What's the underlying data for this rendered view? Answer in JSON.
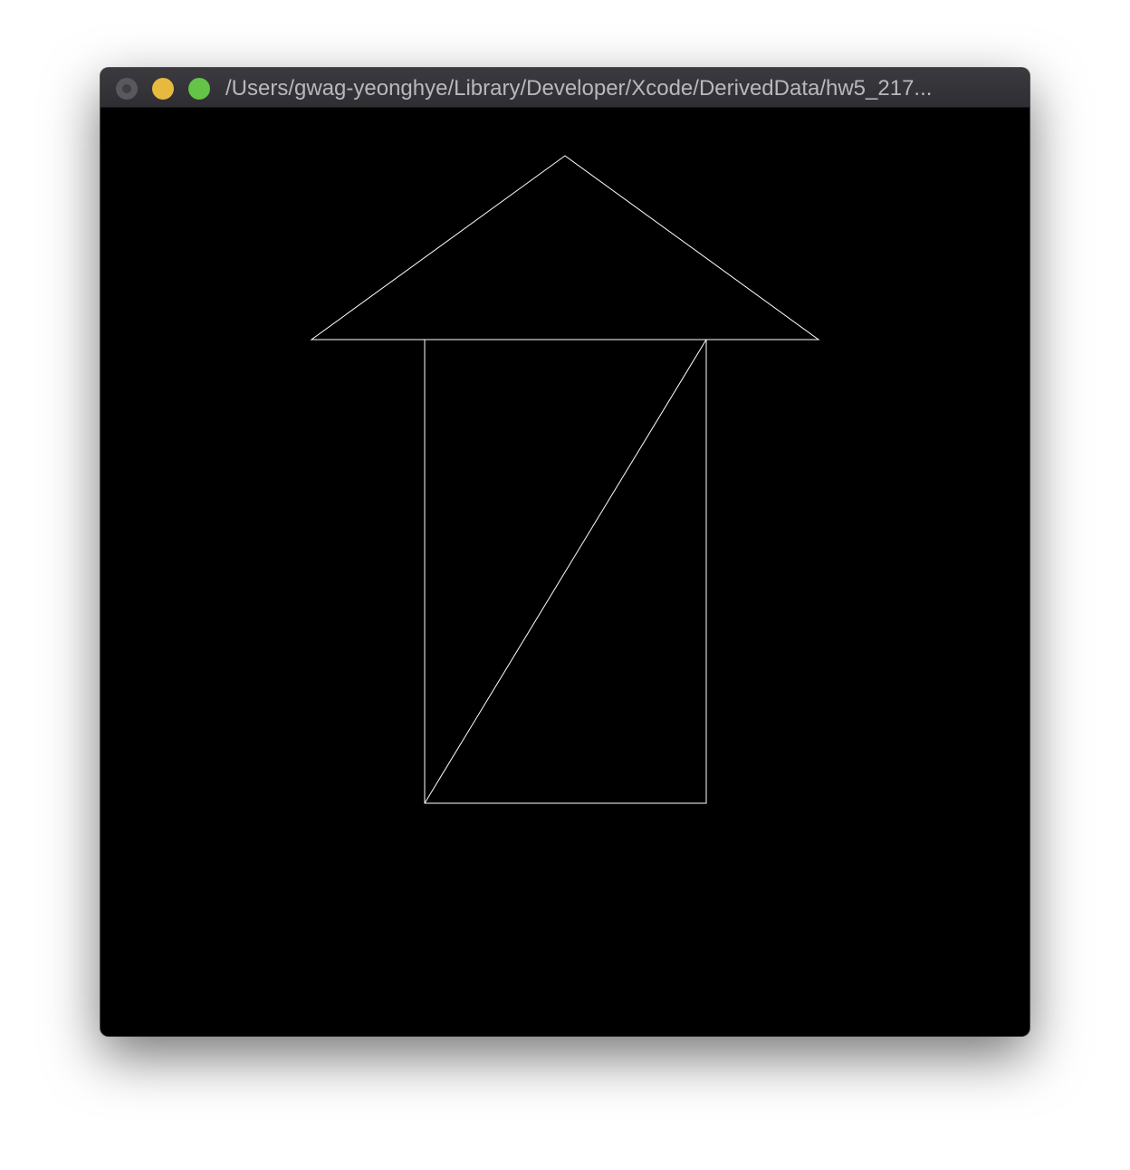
{
  "window": {
    "title": "/Users/gwag-yeonghye/Library/Developer/Xcode/DerivedData/hw5_217...",
    "controls": {
      "close_icon": "close-icon",
      "minimize_icon": "minimize-icon",
      "maximize_icon": "maximize-icon"
    }
  },
  "canvas": {
    "background_color": "#000000",
    "line_color": "#ffffff",
    "shapes": [
      "triangle",
      "rectangle",
      "diagonal-line"
    ]
  }
}
